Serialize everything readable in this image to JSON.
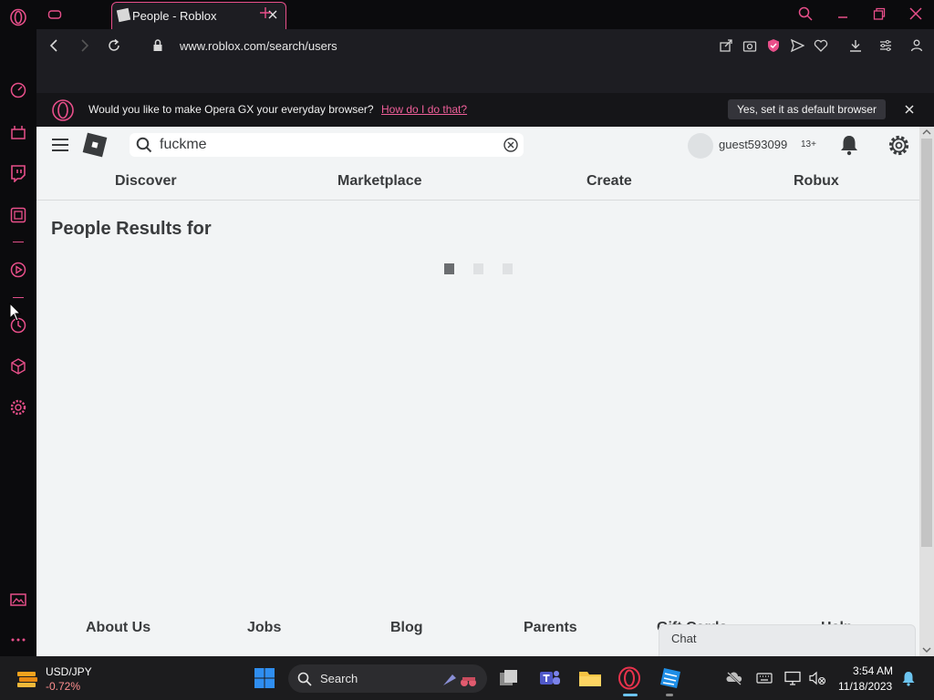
{
  "browser": {
    "tab_title": "People - Roblox",
    "url": "www.roblox.com/search/users",
    "colors": {
      "accent": "#e84f8a",
      "dark": "#1d1d22"
    }
  },
  "infobar": {
    "message": "Would you like to make Opera GX your everyday browser?",
    "link": "How do I do that?",
    "button": "Yes, set it as default browser"
  },
  "roblox": {
    "search_value": "fuckme",
    "username": "guest593099",
    "age_badge": "13+",
    "nav": [
      "Discover",
      "Marketplace",
      "Create",
      "Robux"
    ],
    "results_title": "People Results for",
    "footer_links": [
      "About Us",
      "Jobs",
      "Blog",
      "Parents",
      "Gift Cards",
      "Help"
    ],
    "chat_label": "Chat"
  },
  "taskbar": {
    "ticker_symbol": "USD/JPY",
    "ticker_change": "-0.72%",
    "search_label": "Search",
    "time": "3:54 AM",
    "date": "11/18/2023"
  }
}
